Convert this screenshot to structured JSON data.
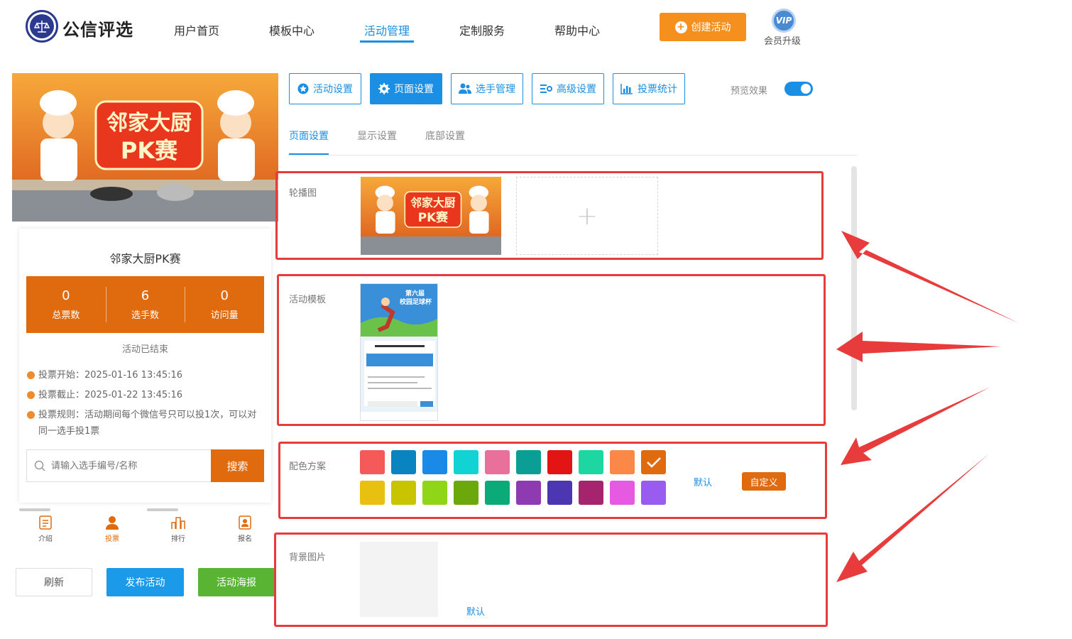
{
  "header": {
    "brand": "公信评选",
    "nav": [
      "用户首页",
      "模板中心",
      "活动管理",
      "定制服务",
      "帮助中心"
    ],
    "active_nav": "活动管理",
    "create_button": "创建活动",
    "vip_badge": "VIP",
    "vip_label": "会员升级"
  },
  "left_panel": {
    "banner_title_line1": "邻家大厨",
    "banner_title_line2": "PK赛",
    "activity_title": "邻家大厨PK赛",
    "stats": [
      {
        "value": "0",
        "label": "总票数"
      },
      {
        "value": "6",
        "label": "选手数"
      },
      {
        "value": "0",
        "label": "访问量"
      }
    ],
    "status": "活动已结束",
    "vote_start": "投票开始：2025-01-16 13:45:16",
    "vote_end": "投票截止：2025-01-22 13:45:16",
    "vote_rule": "投票规则：活动期间每个微信号只可以投1次，可以对同一选手投1票",
    "search_placeholder": "请输入选手编号/名称",
    "search_button": "搜索",
    "tabbar": [
      {
        "label": "介绍",
        "icon": "document-icon"
      },
      {
        "label": "投票",
        "icon": "user-icon"
      },
      {
        "label": "排行",
        "icon": "ranking-icon"
      },
      {
        "label": "报名",
        "icon": "signup-icon"
      }
    ],
    "buttons": {
      "refresh": "刷新",
      "publish": "发布活动",
      "poster": "活动海报"
    }
  },
  "right_panel": {
    "top_tabs": [
      {
        "label": "活动设置",
        "icon": "star-icon"
      },
      {
        "label": "页面设置",
        "icon": "gear-icon"
      },
      {
        "label": "选手管理",
        "icon": "users-icon"
      },
      {
        "label": "高级设置",
        "icon": "settings-list-icon"
      },
      {
        "label": "投票统计",
        "icon": "bar-chart-icon"
      }
    ],
    "active_tab": "页面设置",
    "preview_label": "预览效果",
    "preview_enabled": true,
    "sub_tabs": [
      "页面设置",
      "显示设置",
      "底部设置"
    ],
    "sections": {
      "carousel": "轮播图",
      "template": "活动模板",
      "color_scheme": "配色方案",
      "background": "背景图片"
    },
    "template_preview": {
      "title_line1": "第六届",
      "title_line2": "校园足球杯"
    },
    "colors_row1": [
      "#f45a5a",
      "#0a84c0",
      "#1a8ae8",
      "#12d3d3",
      "#e9709a",
      "#0a9e94",
      "#e31414",
      "#1dd6a2",
      "#fb8846",
      "#e06a0e"
    ],
    "colors_row2": [
      "#e8c010",
      "#c8c400",
      "#8ed617",
      "#6aa80c",
      "#0aaa79",
      "#8e3ab0",
      "#4d36b2",
      "#a6246e",
      "#e55ae0",
      "#9a5cf0"
    ],
    "selected_color": "#e06a0e",
    "default_link": "默认",
    "custom_button": "自定义",
    "bg_default_link": "默认"
  },
  "annotation_color": "#e83b3b"
}
